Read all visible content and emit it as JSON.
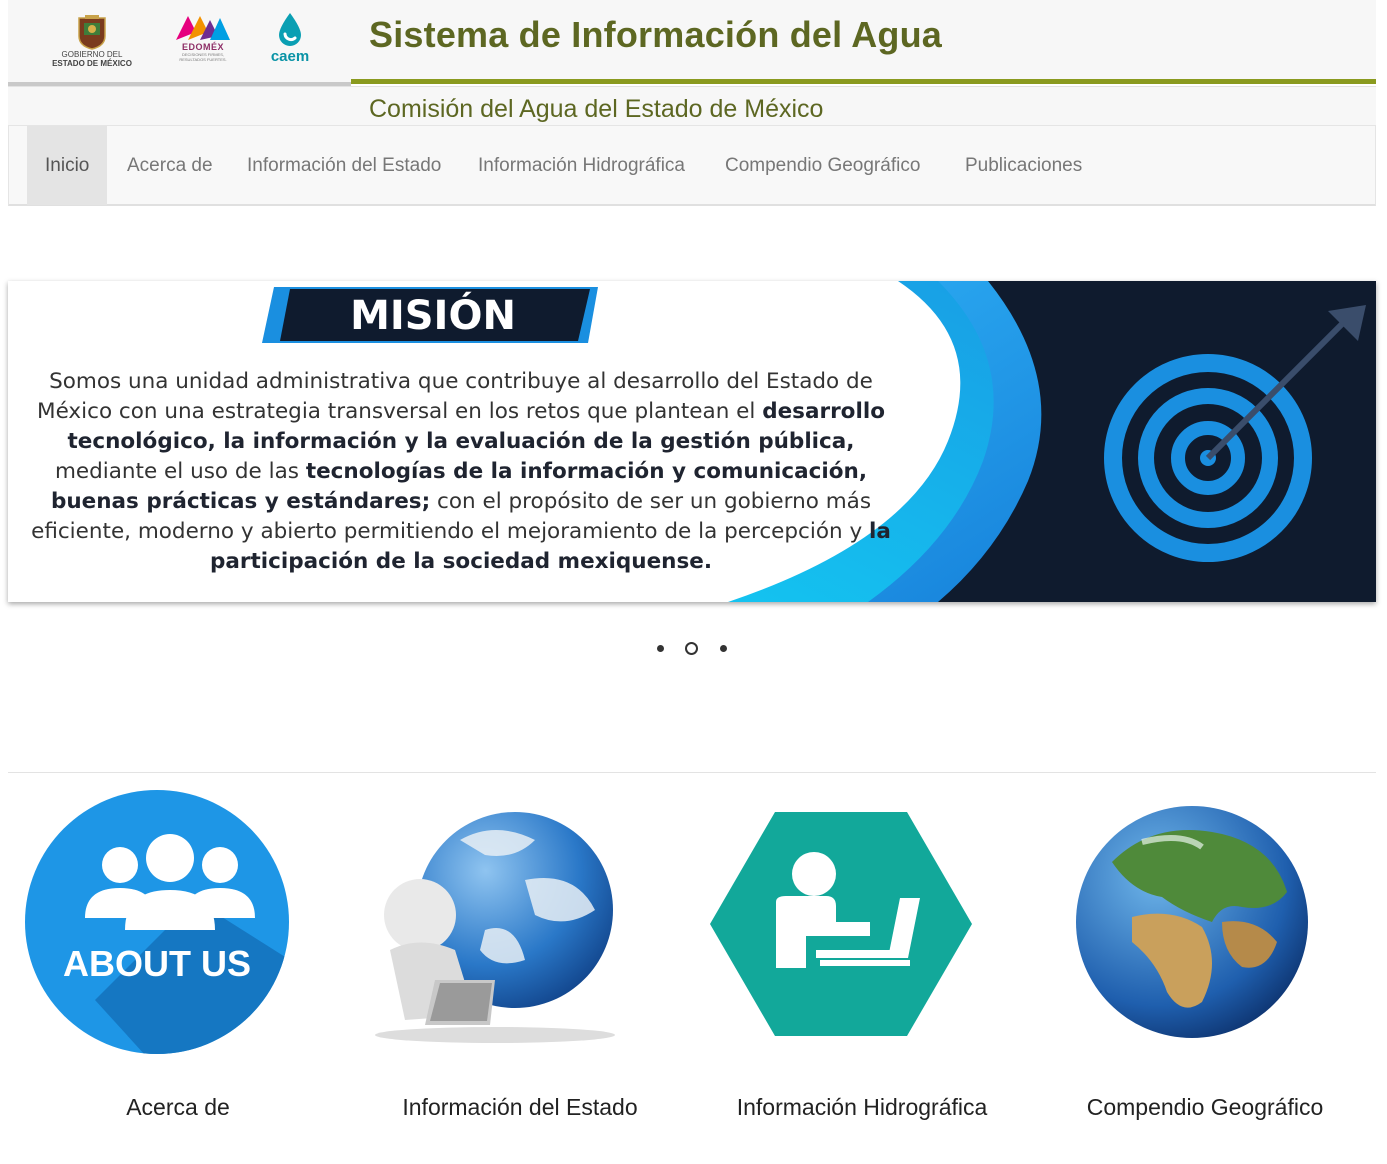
{
  "header": {
    "title": "Sistema de Información del Agua",
    "subtitle": "Comisión del Agua del Estado de México",
    "logos": {
      "gem_line1": "GOBIERNO DEL",
      "gem_line2": "ESTADO DE MÉXICO",
      "edomex": "EDOMÉX",
      "edomex_sub1": "DECISIONES FIRMES,",
      "edomex_sub2": "RESULTADOS FUERTES.",
      "caem": "caem"
    }
  },
  "nav": {
    "items": [
      {
        "label": "Inicio",
        "active": true
      },
      {
        "label": "Acerca de"
      },
      {
        "label": "Información del Estado"
      },
      {
        "label": "Información Hidrográfica"
      },
      {
        "label": "Compendio Geográfico"
      },
      {
        "label": "Publicaciones"
      }
    ]
  },
  "banner": {
    "title": "MISIÓN",
    "body": [
      {
        "t": "Somos una unidad administrativa que contribuye al desarrollo del Estado de México con una estrategia transversal en los retos que plantean el ",
        "b": false
      },
      {
        "t": "desarrollo tecnológico, la información y la evaluación de la gestión pública,",
        "b": true
      },
      {
        "t": " mediante el uso de las ",
        "b": false
      },
      {
        "t": "tecnologías de la información y comunicación, buenas prácticas y estándares;",
        "b": true
      },
      {
        "t": " con el propósito de ser un gobierno más eficiente, moderno y abierto permitiendo el mejoramiento de la percepción y ",
        "b": false
      },
      {
        "t": "la participación de la sociedad mexiquense.",
        "b": true
      }
    ],
    "slides_total": 3,
    "current_slide": 2
  },
  "cards": [
    {
      "label": "Acerca de",
      "image_text": "ABOUT US",
      "icon": "about-us-icon"
    },
    {
      "label": "Información del Estado",
      "icon": "globe-laptop-icon"
    },
    {
      "label": "Información Hidrográfica",
      "icon": "person-laptop-icon"
    },
    {
      "label": "Compendio Geográfico",
      "icon": "earth-globe-icon"
    }
  ],
  "colors": {
    "title_green": "#5d6722",
    "title_rule": "#8a9a1f",
    "banner_navy": "#0f1b2e",
    "banner_blue": "#1a8fe0",
    "about_blue": "#1e96e6",
    "hex_teal": "#12a89a"
  }
}
